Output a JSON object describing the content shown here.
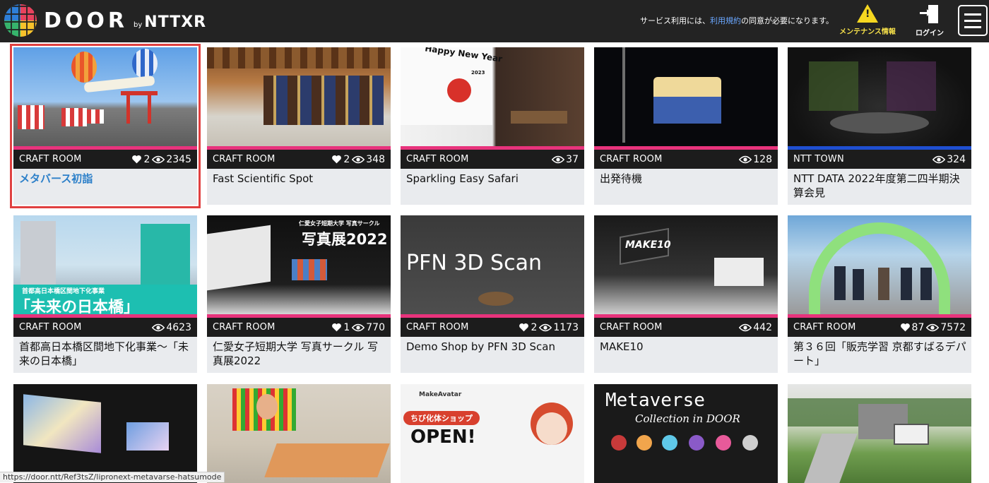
{
  "header": {
    "logo_main": "DOOR",
    "logo_by": "by",
    "logo_brand": "NTTXR",
    "notice_prefix": "サービス利用には、",
    "notice_link": "利用規約",
    "notice_suffix": "の同意が必要になります。",
    "maintenance_label": "メンテナンス情報",
    "login_label": "ログイン"
  },
  "colors": {
    "accent_pink": "#e8337c",
    "accent_blue": "#1f4fd1",
    "selection": "#e04040",
    "link": "#2d80c9"
  },
  "cards": [
    {
      "type": "CRAFT ROOM",
      "likes": "2",
      "views": "2345",
      "title": "メタバース初詣"
    },
    {
      "type": "CRAFT ROOM",
      "likes": "2",
      "views": "348",
      "title": "Fast Scientific Spot"
    },
    {
      "type": "CRAFT ROOM",
      "likes": "",
      "views": "37",
      "title": "Sparkling Easy Safari",
      "thumb_text": "Happy New Year",
      "thumb_text2": "2023"
    },
    {
      "type": "CRAFT ROOM",
      "likes": "",
      "views": "128",
      "title": "出発待機"
    },
    {
      "type": "NTT TOWN",
      "likes": "",
      "views": "324",
      "title": "NTT DATA 2022年度第二四半期決算会見"
    },
    {
      "type": "CRAFT ROOM",
      "likes": "",
      "views": "4623",
      "title": "首都高日本橋区間地下化事業〜「未来の日本橋」",
      "thumb_text": "首都高日本橋区間地下化事業",
      "thumb_text2": "「未来の日本橋」"
    },
    {
      "type": "CRAFT ROOM",
      "likes": "1",
      "views": "770",
      "title": "仁愛女子短期大学 写真サークル 写真展2022",
      "thumb_text": "仁愛女子短期大学 写真サークル",
      "thumb_text2": "写真展2022"
    },
    {
      "type": "CRAFT ROOM",
      "likes": "2",
      "views": "1173",
      "title": "Demo Shop by PFN 3D Scan",
      "thumb_text": "PFN 3D Scan"
    },
    {
      "type": "CRAFT ROOM",
      "likes": "",
      "views": "442",
      "title": "MAKE10",
      "thumb_text": "MAKE10"
    },
    {
      "type": "CRAFT ROOM",
      "likes": "87",
      "views": "7572",
      "title": "第３６回「販売学習 京都すばるデパート」"
    },
    {
      "thumb_text": ""
    },
    {
      "thumb_text": ""
    },
    {
      "thumb_text": "MakeAvatar",
      "thumb_text2": "ちび化体ショップ",
      "thumb_text3": "OPEN!"
    },
    {
      "thumb_text": "Metaverse",
      "thumb_text2": "Collection in DOOR"
    },
    {
      "thumb_text": ""
    }
  ],
  "status_url": "https://door.ntt/Ref3tsZ/lipronext-metavarse-hatsumode"
}
